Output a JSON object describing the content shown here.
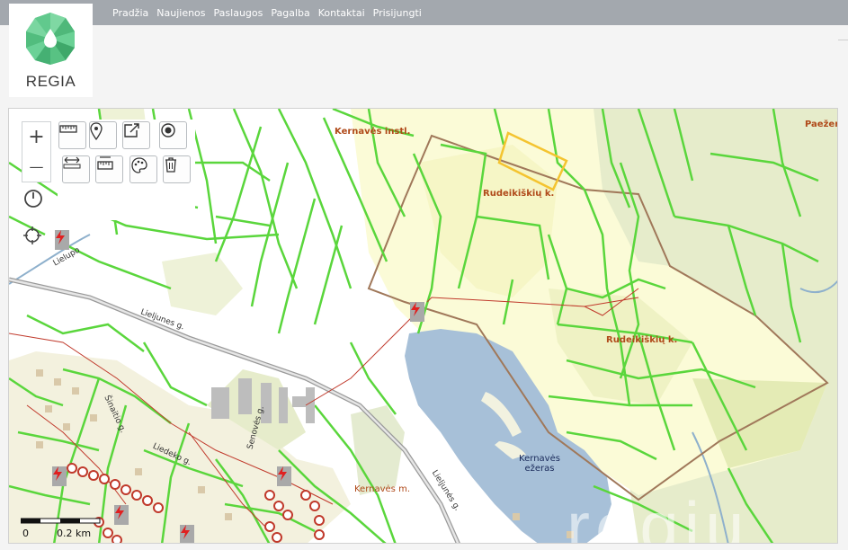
{
  "app": {
    "logo_text": "REGIA",
    "brand_color": "#5dbf8a"
  },
  "nav": {
    "items": [
      "Pradžia",
      "Naujienos",
      "Paslaugos",
      "Pagalba",
      "Kontaktai",
      "Prisijungti"
    ]
  },
  "map": {
    "labels": {
      "kernaves_instl": "Kernavės instl.",
      "rudeikiskiu_n": "Rudeikiškių k.",
      "rudeikiskiu_s": "Rudeikiškių k.",
      "kernaves_m": "Kernavės m.",
      "paezere": "Paežerė",
      "lake_line1": "Kernavės",
      "lake_line2": "ežeras",
      "road_lieljunes": "Lieljunes g.",
      "road_lieljunes2": "Lieljunės g.",
      "road_lielupo": "Lielupo",
      "road_sinaitio": "Šinaitio g.",
      "road_senoves": "Senovės g.",
      "road_liedeko": "Liedeko g."
    },
    "scale": {
      "zero": "0",
      "distance": "0.2 km"
    },
    "watermark": "regiu",
    "colors": {
      "parcel": "#5ad63c",
      "field": "#fbfbdc",
      "forest": "#e7edc7",
      "water": "#a7c0d8",
      "boundary": "#a0785a",
      "power": "#c0392b"
    }
  },
  "controls": {
    "zoom_in": "+",
    "zoom_out": "—"
  }
}
